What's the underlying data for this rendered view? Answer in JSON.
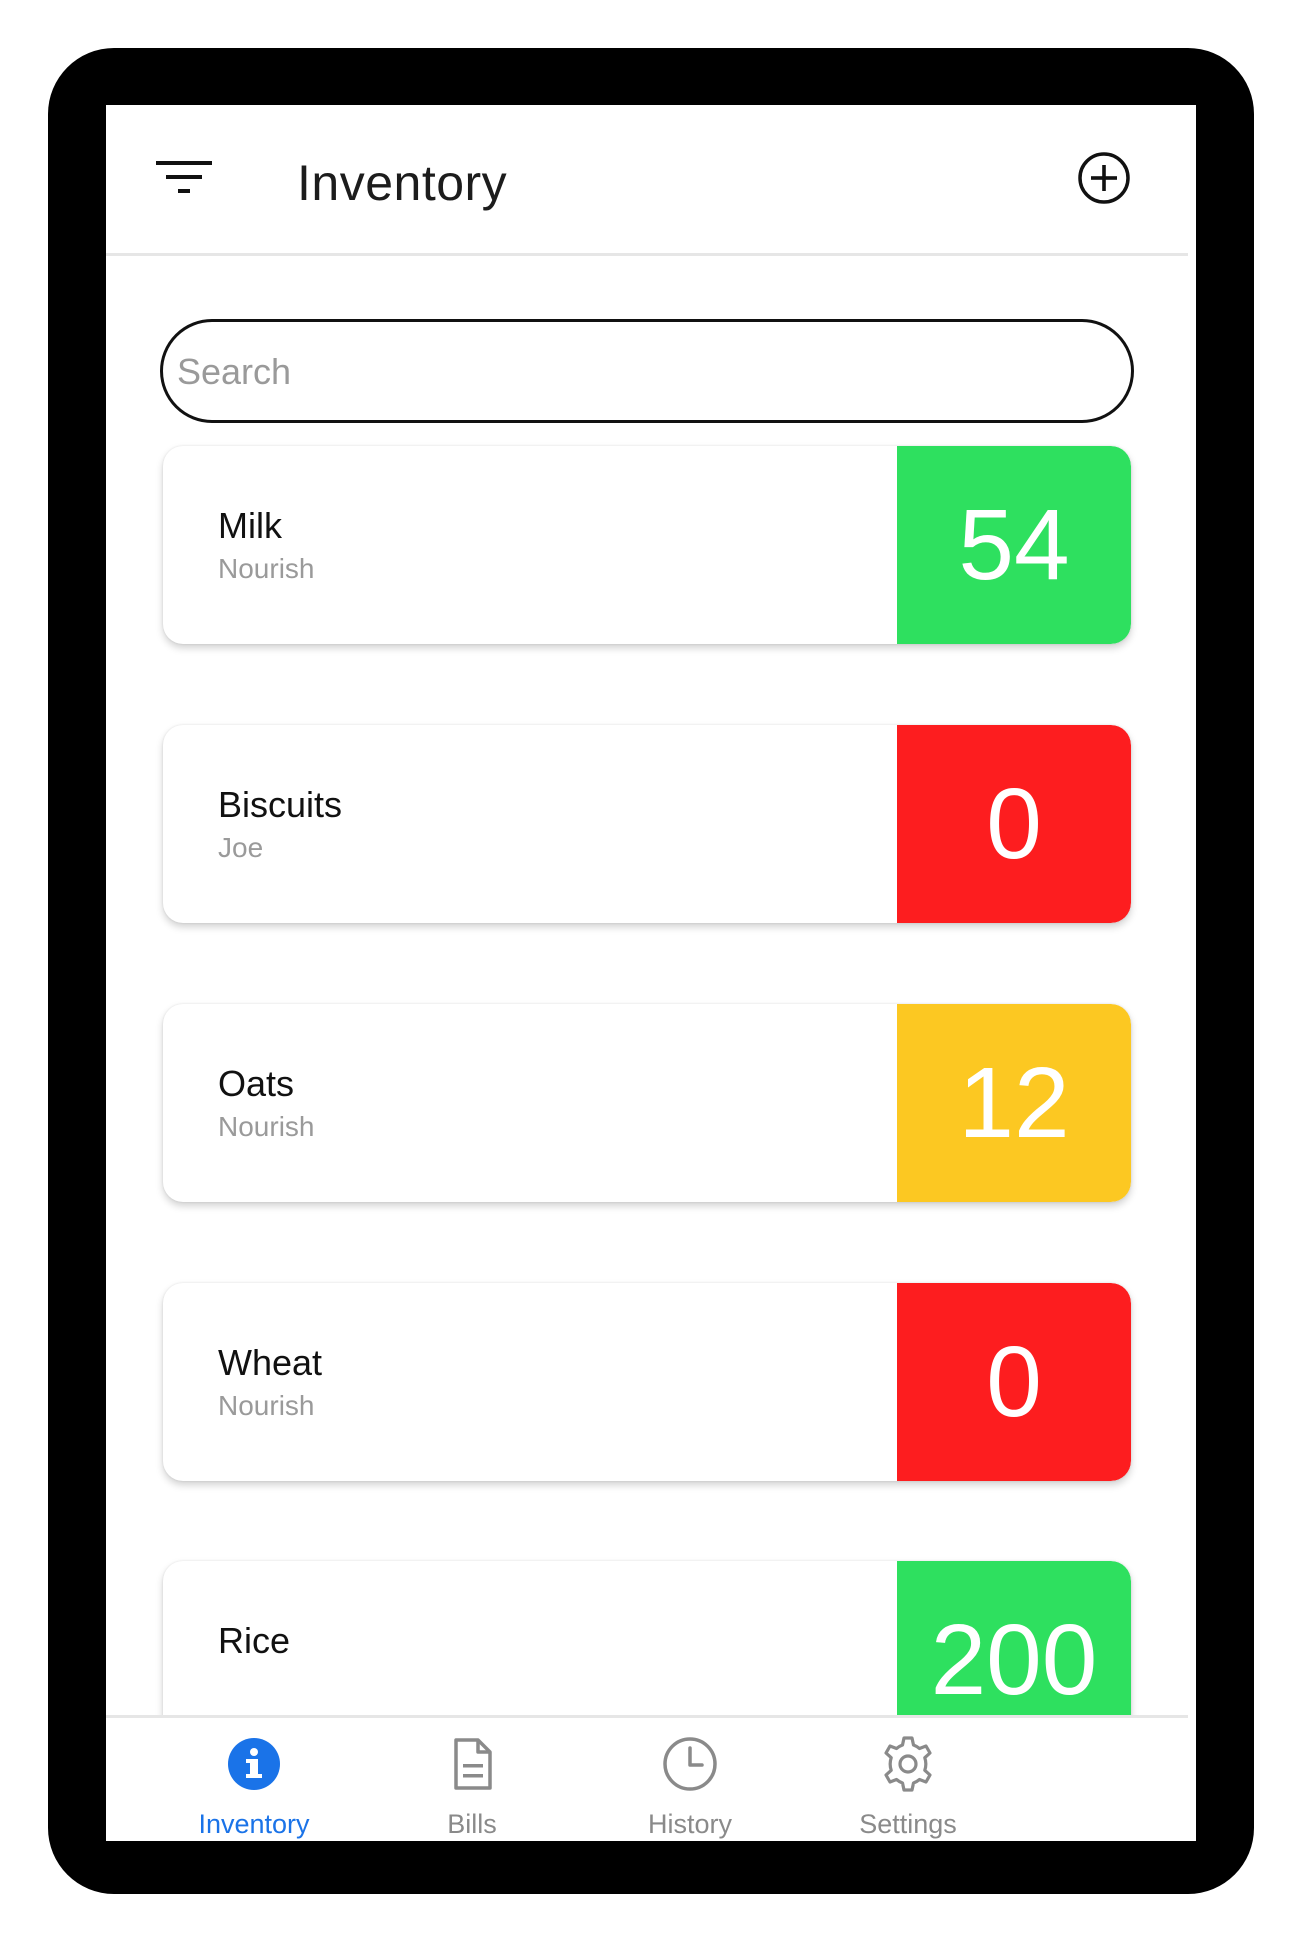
{
  "header": {
    "title": "Inventory",
    "filter_icon": "filter-icon",
    "add_icon": "add-circle-icon"
  },
  "search": {
    "placeholder": "Search",
    "value": ""
  },
  "items": [
    {
      "name": "Milk",
      "brand": "Nourish",
      "quantity": "54",
      "status_color": "#2ee05f"
    },
    {
      "name": "Biscuits",
      "brand": "Joe",
      "quantity": "0",
      "status_color": "#fd1d1f"
    },
    {
      "name": "Oats",
      "brand": "Nourish",
      "quantity": "12",
      "status_color": "#fcc822"
    },
    {
      "name": "Wheat",
      "brand": "Nourish",
      "quantity": "0",
      "status_color": "#fd1d1f"
    },
    {
      "name": "Rice",
      "brand": "",
      "quantity": "200",
      "status_color": "#2ee05f"
    }
  ],
  "nav": {
    "active_color": "#1a73e8",
    "inactive_color": "#8a8a8a",
    "items": [
      {
        "label": "Inventory",
        "icon": "info-icon",
        "active": true
      },
      {
        "label": "Bills",
        "icon": "document-icon",
        "active": false
      },
      {
        "label": "History",
        "icon": "clock-icon",
        "active": false
      },
      {
        "label": "Settings",
        "icon": "gear-icon",
        "active": false
      }
    ]
  }
}
